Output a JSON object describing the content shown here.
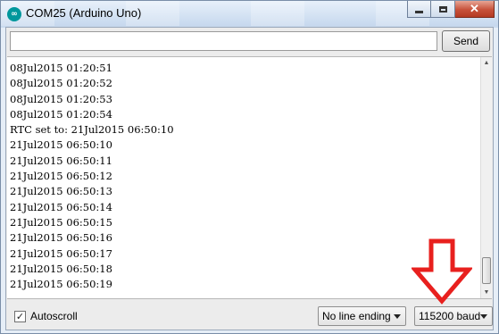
{
  "window": {
    "title": "COM25 (Arduino Uno)",
    "app_icon_glyph": "∞",
    "close_glyph": "✕"
  },
  "send": {
    "input_value": "",
    "button_label": "Send"
  },
  "serial_output": {
    "lines": [
      "08Jul2015 01:20:51",
      "08Jul2015 01:20:52",
      "08Jul2015 01:20:53",
      "08Jul2015 01:20:54",
      "RTC set to: 21Jul2015 06:50:10",
      "21Jul2015 06:50:10",
      "21Jul2015 06:50:11",
      "21Jul2015 06:50:12",
      "21Jul2015 06:50:13",
      "21Jul2015 06:50:14",
      "21Jul2015 06:50:15",
      "21Jul2015 06:50:16",
      "21Jul2015 06:50:17",
      "21Jul2015 06:50:18",
      "21Jul2015 06:50:19"
    ]
  },
  "bottom": {
    "autoscroll_label": "Autoscroll",
    "autoscroll_checked": true,
    "check_glyph": "✓",
    "line_ending_value": "No line ending",
    "baud_value": "115200 baud"
  },
  "colors": {
    "annotation_arrow": "#e8201e",
    "arduino_teal": "#00979c"
  },
  "icons": {
    "app": "arduino-logo-icon",
    "minimize": "minimize-icon",
    "maximize": "maximize-icon",
    "close": "close-icon",
    "dropdown": "chevron-down-icon",
    "annotation": "arrow-down-icon"
  }
}
